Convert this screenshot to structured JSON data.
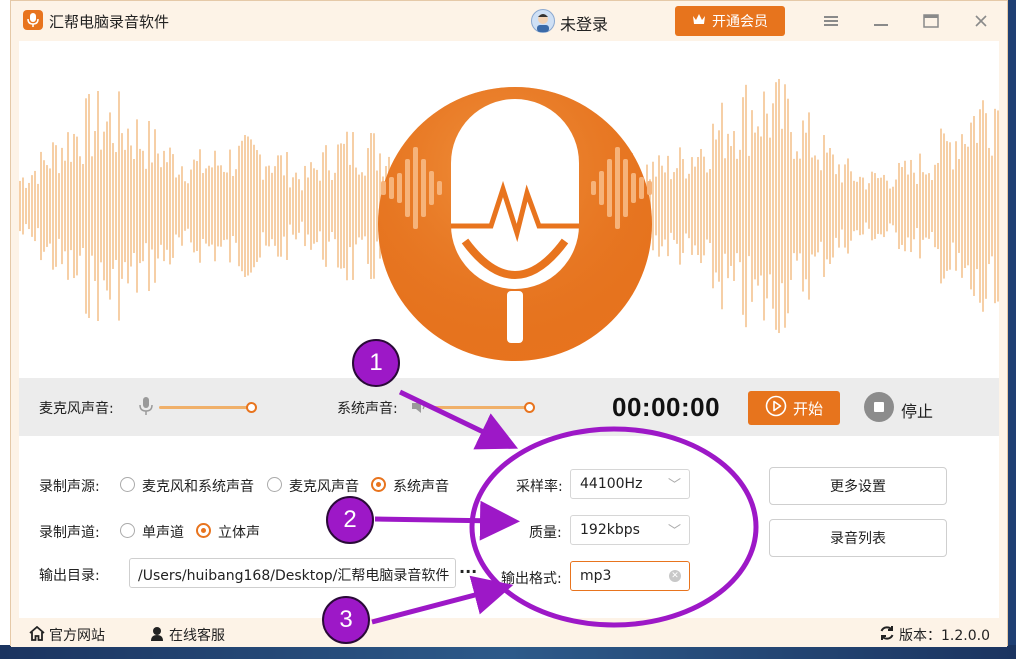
{
  "app": {
    "title": "汇帮电脑录音软件",
    "login_text": "未登录",
    "vip_label": "开通会员"
  },
  "controls": {
    "mic_label": "麦克风声音:",
    "system_label": "系统声音:",
    "mic_level": 1.0,
    "system_level": 1.0,
    "timer": "00:00:00",
    "start_label": "开始",
    "stop_label": "停止"
  },
  "settings": {
    "source_label": "录制声源:",
    "source_options": [
      "麦克风和系统声音",
      "麦克风声音",
      "系统声音"
    ],
    "source_selected": "系统声音",
    "channel_label": "录制声道:",
    "channel_options": [
      "单声道",
      "立体声"
    ],
    "channel_selected": "立体声",
    "output_label": "输出目录:",
    "output_path": "/Users/huibang168/Desktop/汇帮电脑录音软件",
    "more_glyph": "···",
    "sample_rate_label": "采样率:",
    "sample_rate_value": "44100Hz",
    "quality_label": "质量:",
    "quality_value": "192kbps",
    "format_label": "输出格式:",
    "format_value": "mp3",
    "more_settings": "更多设置",
    "record_list": "录音列表"
  },
  "footer": {
    "website": "官方网站",
    "support": "在线客服",
    "version": "版本：1.2.0.0"
  },
  "annotations": {
    "badges": [
      "1",
      "2",
      "3"
    ]
  },
  "colors": {
    "accent": "#e7741d",
    "annotation": "#9d18c7",
    "wave": "#f6cfa6"
  },
  "icons": [
    "app-logo-icon",
    "avatar-icon",
    "crown-icon",
    "menu-icon",
    "minimize-icon",
    "maximize-icon",
    "close-icon",
    "microphone-icon",
    "speaker-icon",
    "play-icon",
    "stop-icon",
    "home-icon",
    "headset-icon",
    "refresh-icon"
  ]
}
